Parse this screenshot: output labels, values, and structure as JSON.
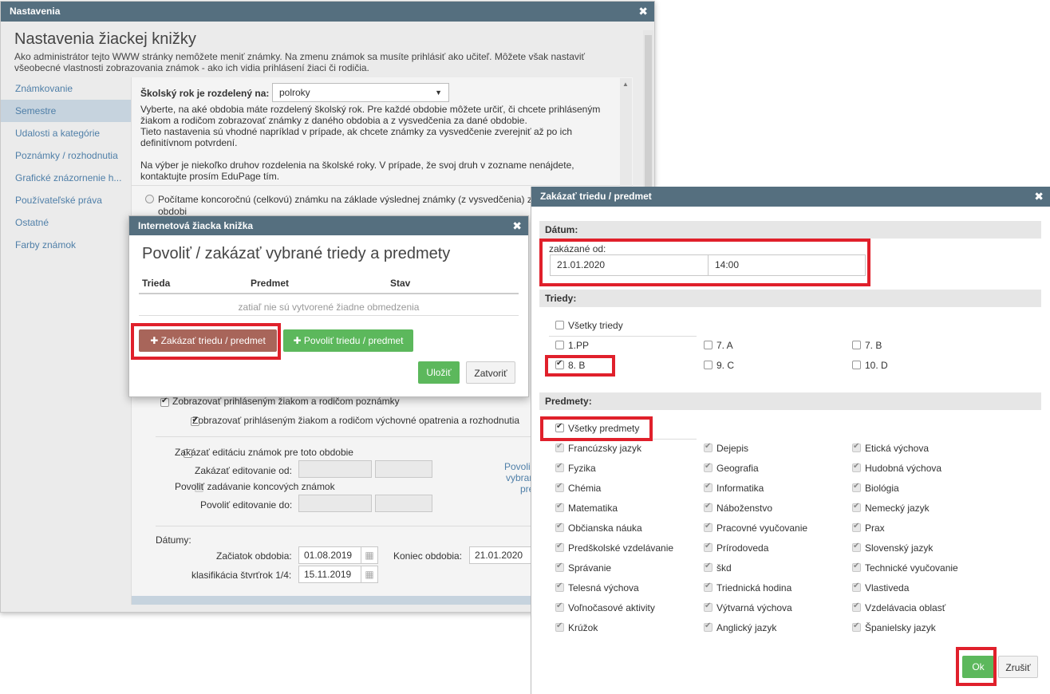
{
  "main_window": {
    "title": "Nastavenia",
    "heading": "Nastavenia žiackej knižky",
    "description_line1": "Ako administrátor tejto WWW stránky nemôžete meniť známky. Na zmenu známok sa musíte prihlásiť ako učiteľ. Môžete však nastaviť",
    "description_line2": "všeobecné vlastnosti zobrazovania známok - ako ich vidia prihlásení žiaci či rodičia.",
    "nav": [
      {
        "label": "Známkovanie"
      },
      {
        "label": "Semestre"
      },
      {
        "label": "Udalosti a kategórie"
      },
      {
        "label": "Poznámky / rozhodnutia"
      },
      {
        "label": "Grafické znázornenie h..."
      },
      {
        "label": "Používateľské práva"
      },
      {
        "label": "Ostatné"
      },
      {
        "label": "Farby známok"
      }
    ],
    "school_year_label": "Školský rok je rozdelený na:",
    "school_year_value": "polroky",
    "info_p1_l1": "Vyberte, na aké obdobia máte rozdelený školský rok. Pre každé obdobie môžete určiť, či chcete prihláseným",
    "info_p1_l2": "žiakom a rodičom zobrazovať známky z daného obdobia a z vysvedčenia za dané obdobie.",
    "info_p1_l3": "Tieto nastavenia sú vhodné napríklad v prípade, ak chcete známky za vysvedčenie zverejniť až po ich",
    "info_p1_l4": "definitívnom potvrdení.",
    "info_p2_l1": "Na výber je niekoľko druhov rozdelenia na školské roky. V prípade, že svoj druh v zozname nenájdete,",
    "info_p2_l2": "kontaktujte prosím EduPage tím.",
    "radio_text_l1": "Počítame koncoročnú (celkovú) známku na základe výslednej známky (z vysvedčenia) z",
    "radio_text_l2": "obdobi",
    "opt_notes": "Zobrazovať prihláseným žiakom a rodičom poznámky",
    "opt_measures": "Zobrazovať prihláseným žiakom a rodičom výchovné opatrenia a rozhodnutia",
    "opt_disable_edit": "Zakázať editáciu známok pre toto obdobie",
    "disable_edit_from": "Zakázať editovanie od:",
    "opt_allow_final": "Povoliť zadávanie koncových známok",
    "allow_edit_to": "Povoliť editovanie do:",
    "side_link_l1": "Povoli",
    "side_link_l2": "vybran",
    "side_link_l3": "pre",
    "dates_label": "Dátumy:",
    "period_start_label": "Začiatok obdobia:",
    "period_start_value": "01.08.2019",
    "period_end_label": "Koniec obdobia:",
    "period_end_value": "21.01.2020",
    "quarter_label": "klasifikácia štvrťrok 1/4:",
    "quarter_value": "15.11.2019"
  },
  "modal_inet": {
    "title": "Internetová žiacka knižka",
    "heading": "Povoliť / zakázať vybrané triedy a predmety",
    "col_class": "Trieda",
    "col_subject": "Predmet",
    "col_state": "Stav",
    "empty_text": "zatiaľ nie sú vytvorené žiadne obmedzenia",
    "btn_disable": "Zakázať triedu / predmet",
    "btn_enable": "Povoliť triedu / predmet",
    "btn_save": "Uložiť",
    "btn_close": "Zatvoriť"
  },
  "dialog": {
    "title": "Zakázať triedu / predmet",
    "date_section": "Dátum:",
    "disabled_from_label": "zakázané od:",
    "date_value": "21.01.2020",
    "time_value": "14:00",
    "classes_section": "Triedy:",
    "all_classes": "Všetky triedy",
    "classes": [
      {
        "label": "1.PP",
        "checked": false
      },
      {
        "label": "7. A",
        "checked": false
      },
      {
        "label": "7. B",
        "checked": false
      },
      {
        "label": "8. B",
        "checked": true
      },
      {
        "label": "9. C",
        "checked": false
      },
      {
        "label": "10. D",
        "checked": false
      }
    ],
    "subjects_section": "Predmety:",
    "all_subjects": "Všetky predmety",
    "subjects": [
      "Francúzsky jazyk",
      "Dejepis",
      "Etická výchova",
      "Fyzika",
      "Geografia",
      "Hudobná výchova",
      "Chémia",
      "Informatika",
      "Biológia",
      "Matematika",
      "Náboženstvo",
      "Nemecký jazyk",
      "Občianska náuka",
      "Pracovné vyučovanie",
      "Prax",
      "Predškolské vzdelávanie",
      "Prírodoveda",
      "Slovenský jazyk",
      "Správanie",
      "škd",
      "Technické vyučovanie",
      "Telesná výchova",
      "Triednická hodina",
      "Vlastiveda",
      "Voľnočasové aktivity",
      "Výtvarná výchova",
      "Vzdelávacia oblasť",
      "Krúžok",
      "Anglický jazyk",
      "Španielsky jazyk"
    ],
    "btn_ok": "Ok",
    "btn_cancel": "Zrušiť"
  },
  "colors": {
    "titlebar": "#556f7f",
    "accent_red": "#e0202b",
    "green": "#5cb85c",
    "brown": "#a8655a",
    "link": "#4f7fa8"
  },
  "icons": [
    "close-icon",
    "plus-icon",
    "calendar-icon",
    "chevron-down-icon",
    "checkbox-icon",
    "radio-icon"
  ]
}
